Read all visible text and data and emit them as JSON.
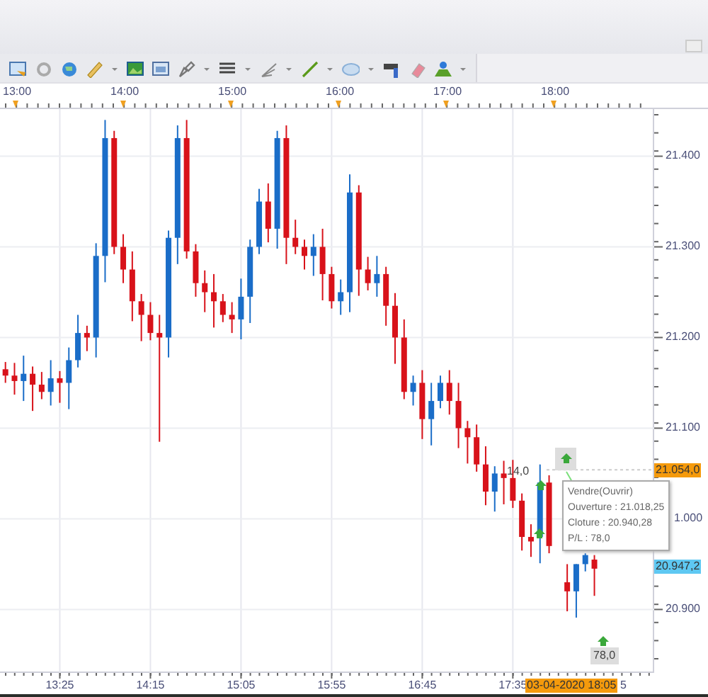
{
  "time_axis_top": {
    "labels": [
      "13:00",
      "14:00",
      "15:00",
      "16:00",
      "17:00",
      "18:00"
    ]
  },
  "chart": {
    "chart_data": {
      "type": "candlestick",
      "x": [
        775,
        780,
        785,
        790,
        795,
        800,
        805,
        810,
        815,
        820,
        825,
        830,
        835,
        840,
        845,
        850,
        855,
        860,
        865,
        870,
        875,
        880,
        885,
        890,
        895,
        900,
        905,
        910,
        915,
        920,
        925,
        930,
        935,
        940,
        945,
        950,
        955,
        960,
        965,
        970,
        975,
        980,
        985,
        990,
        995,
        1000,
        1005,
        1010,
        1015,
        1020,
        1025,
        1030,
        1035,
        1040,
        1045,
        1050,
        1055,
        1060,
        1065,
        1070,
        1075,
        null,
        1085,
        1090,
        1095,
        1100
      ],
      "xlim": [
        772,
        1133
      ],
      "xticks": [
        {
          "value": 805,
          "label": "13:25"
        },
        {
          "value": 855,
          "label": "14:15"
        },
        {
          "value": 905,
          "label": "15:05"
        },
        {
          "value": 955,
          "label": "15:55"
        },
        {
          "value": 1005,
          "label": "16:45"
        },
        {
          "value": 1055,
          "label": "17:35"
        }
      ],
      "ohlc": [
        [
          21165,
          21173,
          21150,
          21158
        ],
        [
          21158,
          21172,
          21137,
          21152
        ],
        [
          21152,
          21180,
          21130,
          21160
        ],
        [
          21160,
          21168,
          21119,
          21148
        ],
        [
          21148,
          21162,
          21132,
          21140
        ],
        [
          21140,
          21175,
          21125,
          21155
        ],
        [
          21155,
          21163,
          21128,
          21150
        ],
        [
          21150,
          21189,
          21121,
          21175
        ],
        [
          21175,
          21225,
          21167,
          21205
        ],
        [
          21205,
          21213,
          21185,
          21200
        ],
        [
          21200,
          21304,
          21178,
          21290
        ],
        [
          21290,
          21440,
          21261,
          21420
        ],
        [
          21420,
          21428,
          21292,
          21300
        ],
        [
          21300,
          21314,
          21260,
          21275
        ],
        [
          21275,
          21295,
          21218,
          21240
        ],
        [
          21240,
          21248,
          21196,
          21225
        ],
        [
          21225,
          21239,
          21197,
          21205
        ],
        [
          21205,
          21225,
          21085,
          21200
        ],
        [
          21200,
          21318,
          21178,
          21310
        ],
        [
          21310,
          21434,
          21281,
          21420
        ],
        [
          21420,
          21440,
          21287,
          21295
        ],
        [
          21295,
          21303,
          21245,
          21260
        ],
        [
          21260,
          21274,
          21228,
          21250
        ],
        [
          21250,
          21270,
          21211,
          21240
        ],
        [
          21240,
          21248,
          21217,
          21225
        ],
        [
          21225,
          21239,
          21205,
          21220
        ],
        [
          21220,
          21265,
          21198,
          21245
        ],
        [
          21245,
          21308,
          21216,
          21300
        ],
        [
          21300,
          21364,
          21292,
          21350
        ],
        [
          21350,
          21370,
          21305,
          21320
        ],
        [
          21320,
          21428,
          21298,
          21420
        ],
        [
          21420,
          21434,
          21281,
          21310
        ],
        [
          21310,
          21330,
          21292,
          21300
        ],
        [
          21300,
          21308,
          21275,
          21290
        ],
        [
          21290,
          21314,
          21268,
          21300
        ],
        [
          21300,
          21320,
          21241,
          21270
        ],
        [
          21270,
          21278,
          21232,
          21240
        ],
        [
          21240,
          21264,
          21225,
          21250
        ],
        [
          21250,
          21380,
          21228,
          21360
        ],
        [
          21360,
          21368,
          21246,
          21275
        ],
        [
          21275,
          21289,
          21252,
          21260
        ],
        [
          21260,
          21290,
          21245,
          21270
        ],
        [
          21270,
          21278,
          21213,
          21235
        ],
        [
          21235,
          21249,
          21171,
          21200
        ],
        [
          21200,
          21220,
          21132,
          21140
        ],
        [
          21140,
          21158,
          21125,
          21150
        ],
        [
          21150,
          21164,
          21088,
          21110
        ],
        [
          21110,
          21150,
          21081,
          21130
        ],
        [
          21130,
          21158,
          21122,
          21150
        ],
        [
          21150,
          21164,
          21115,
          21130
        ],
        [
          21130,
          21150,
          21078,
          21100
        ],
        [
          21100,
          21108,
          21061,
          21090
        ],
        [
          21090,
          21104,
          21052,
          21060
        ],
        [
          21060,
          21080,
          21015,
          21030
        ],
        [
          21030,
          21058,
          21008,
          21050
        ],
        [
          21050,
          21064,
          21016,
          21045
        ],
        [
          21045,
          21065,
          21012,
          21020
        ],
        [
          21020,
          21028,
          20965,
          20980
        ],
        [
          20980,
          20994,
          20958,
          20975
        ],
        [
          20980,
          21060,
          20951,
          21040
        ],
        [
          21040,
          21048,
          20962,
          20970
        ],
        null,
        [
          20930,
          20950,
          20898,
          20920
        ],
        [
          20920,
          20950,
          20891,
          20950
        ],
        [
          20950,
          20962,
          20942,
          20960
        ],
        [
          20955,
          20960,
          20915,
          20945
        ]
      ],
      "grid": true,
      "ylim": [
        20830,
        21452
      ],
      "yticks": [
        {
          "value": 21400,
          "label": "21.400"
        },
        {
          "value": 21300,
          "label": "21.300"
        },
        {
          "value": 21200,
          "label": "21.200"
        },
        {
          "value": 21100,
          "label": "21.100"
        },
        {
          "value": 20900,
          "label": "20.900"
        }
      ]
    }
  },
  "price_axis": {
    "partial_label": "1.000",
    "ask_label": "21.054,0",
    "bid_label": "20.947,2"
  },
  "trades": [
    {
      "label": "14,0"
    },
    {
      "label": "78,0"
    }
  ],
  "tooltip": {
    "lines": [
      "Vendre(Ouvrir)",
      "Ouverture : 21.018,25",
      "Cloture : 20.940,28",
      "P/L : 78,0"
    ]
  },
  "time_axis_bottom": {
    "cursor_label": "03-04-2020 18:05",
    "tail_label": "5"
  }
}
